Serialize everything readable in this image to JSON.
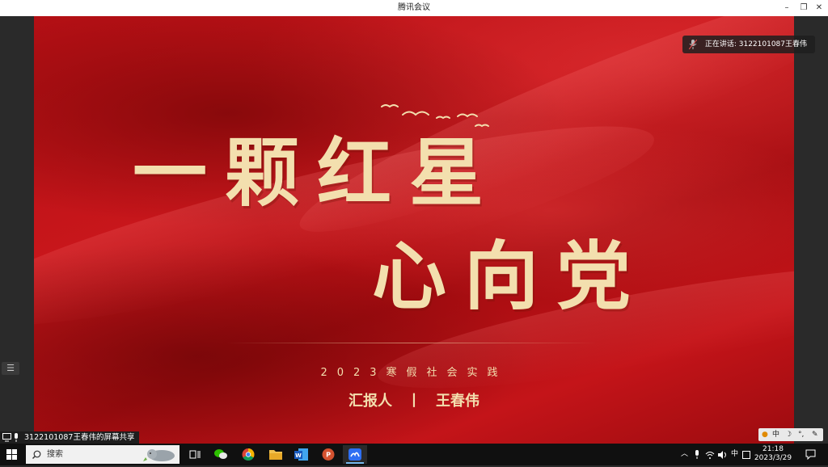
{
  "window": {
    "title": "腾讯会议",
    "min_glyph": "–",
    "restore_glyph": "❐",
    "close_glyph": "✕"
  },
  "speaking": {
    "text": "正在讲话: 3122101087王春伟"
  },
  "slide": {
    "line1": "一颗红星",
    "line2": "心向党",
    "subtitle": "2023寒假社会实践",
    "reporter_label": "汇报人",
    "separator": "丨",
    "reporter_name": "王春伟"
  },
  "share_status": {
    "text": "3122101087王春伟的屏幕共享"
  },
  "ime": {
    "lang": "中"
  },
  "taskbar": {
    "search_placeholder": "搜索",
    "tray_lang": "中",
    "time": "21:18",
    "date": "2023/3/29"
  },
  "colors": {
    "slide_red": "#c8161b",
    "title_gold": "#f3dfae",
    "taskbar": "#101010",
    "active_indicator": "#76b9ed"
  }
}
